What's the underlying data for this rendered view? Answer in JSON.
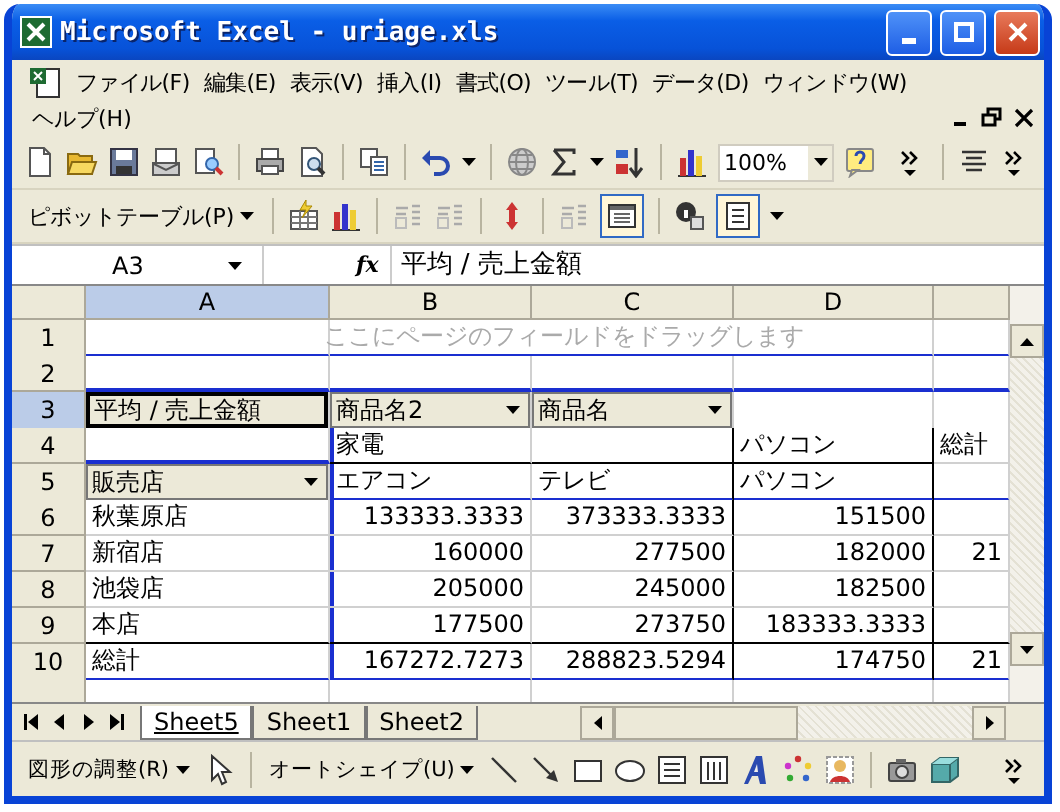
{
  "window": {
    "title": "Microsoft Excel - uriage.xls"
  },
  "menu": [
    {
      "label": "ファイル(F)"
    },
    {
      "label": "編集(E)"
    },
    {
      "label": "表示(V)"
    },
    {
      "label": "挿入(I)"
    },
    {
      "label": "書式(O)"
    },
    {
      "label": "ツール(T)"
    },
    {
      "label": "データ(D)"
    },
    {
      "label": "ウィンドウ(W)"
    },
    {
      "label": "ヘルプ(H)"
    }
  ],
  "standard_toolbar": {
    "zoom": "100%"
  },
  "pivot_toolbar": {
    "menu": "ピボットテーブル(P)"
  },
  "formula_bar": {
    "name_box": "A3",
    "function_label": "fx",
    "formula": "平均 / 売上金額"
  },
  "columns": [
    {
      "label": "A",
      "selected": true
    },
    {
      "label": "B",
      "selected": false
    },
    {
      "label": "C",
      "selected": false
    },
    {
      "label": "D",
      "selected": false
    }
  ],
  "rows": [
    {
      "label": "1",
      "selected": false,
      "cells": [
        null,
        {
          "text": "ここにページのフィールドをドラッグします",
          "kind": "hint"
        },
        null,
        null,
        null
      ]
    },
    {
      "label": "2",
      "selected": false,
      "cells": [
        null,
        null,
        null,
        null,
        null
      ]
    },
    {
      "label": "3",
      "selected": true,
      "cells": [
        {
          "text": "平均 / 売上金額",
          "kind": "field",
          "dropdown": false
        },
        {
          "text": "商品名2",
          "kind": "field",
          "dropdown": true
        },
        {
          "text": "商品名",
          "kind": "field",
          "dropdown": true
        },
        null,
        null
      ]
    },
    {
      "label": "4",
      "selected": false,
      "cells": [
        null,
        {
          "text": "家電",
          "kind": "text"
        },
        null,
        {
          "text": "パソコン",
          "kind": "text"
        },
        {
          "text": "総計",
          "kind": "text"
        }
      ]
    },
    {
      "label": "5",
      "selected": false,
      "cells": [
        {
          "text": "販売店",
          "kind": "field",
          "dropdown": true
        },
        {
          "text": "エアコン",
          "kind": "text"
        },
        {
          "text": "テレビ",
          "kind": "text"
        },
        {
          "text": "パソコン",
          "kind": "text"
        },
        null
      ]
    },
    {
      "label": "6",
      "selected": false,
      "cells": [
        {
          "text": "秋葉原店",
          "kind": "text"
        },
        {
          "text": "133333.3333",
          "kind": "number"
        },
        {
          "text": "373333.3333",
          "kind": "number"
        },
        {
          "text": "151500",
          "kind": "number"
        },
        null
      ]
    },
    {
      "label": "7",
      "selected": false,
      "cells": [
        {
          "text": "新宿店",
          "kind": "text"
        },
        {
          "text": "160000",
          "kind": "number"
        },
        {
          "text": "277500",
          "kind": "number"
        },
        {
          "text": "182000",
          "kind": "number"
        },
        {
          "text": "21",
          "kind": "number"
        }
      ]
    },
    {
      "label": "8",
      "selected": false,
      "cells": [
        {
          "text": "池袋店",
          "kind": "text"
        },
        {
          "text": "205000",
          "kind": "number"
        },
        {
          "text": "245000",
          "kind": "number"
        },
        {
          "text": "182500",
          "kind": "number"
        },
        null
      ]
    },
    {
      "label": "9",
      "selected": false,
      "cells": [
        {
          "text": "本店",
          "kind": "text"
        },
        {
          "text": "177500",
          "kind": "number"
        },
        {
          "text": "273750",
          "kind": "number"
        },
        {
          "text": "183333.3333",
          "kind": "number"
        },
        null
      ]
    },
    {
      "label": "10",
      "selected": false,
      "cells": [
        {
          "text": "総計",
          "kind": "text"
        },
        {
          "text": "167272.7273",
          "kind": "number"
        },
        {
          "text": "288823.5294",
          "kind": "number"
        },
        {
          "text": "174750",
          "kind": "number"
        },
        {
          "text": "21",
          "kind": "number"
        }
      ]
    }
  ],
  "sheet_tabs": [
    {
      "label": "Sheet5",
      "selected": true
    },
    {
      "label": "Sheet1",
      "selected": false
    },
    {
      "label": "Sheet2",
      "selected": false
    }
  ],
  "drawing_toolbar": {
    "draw_menu": "図形の調整(R)",
    "autoshapes_menu": "オートシェイプ(U)"
  }
}
